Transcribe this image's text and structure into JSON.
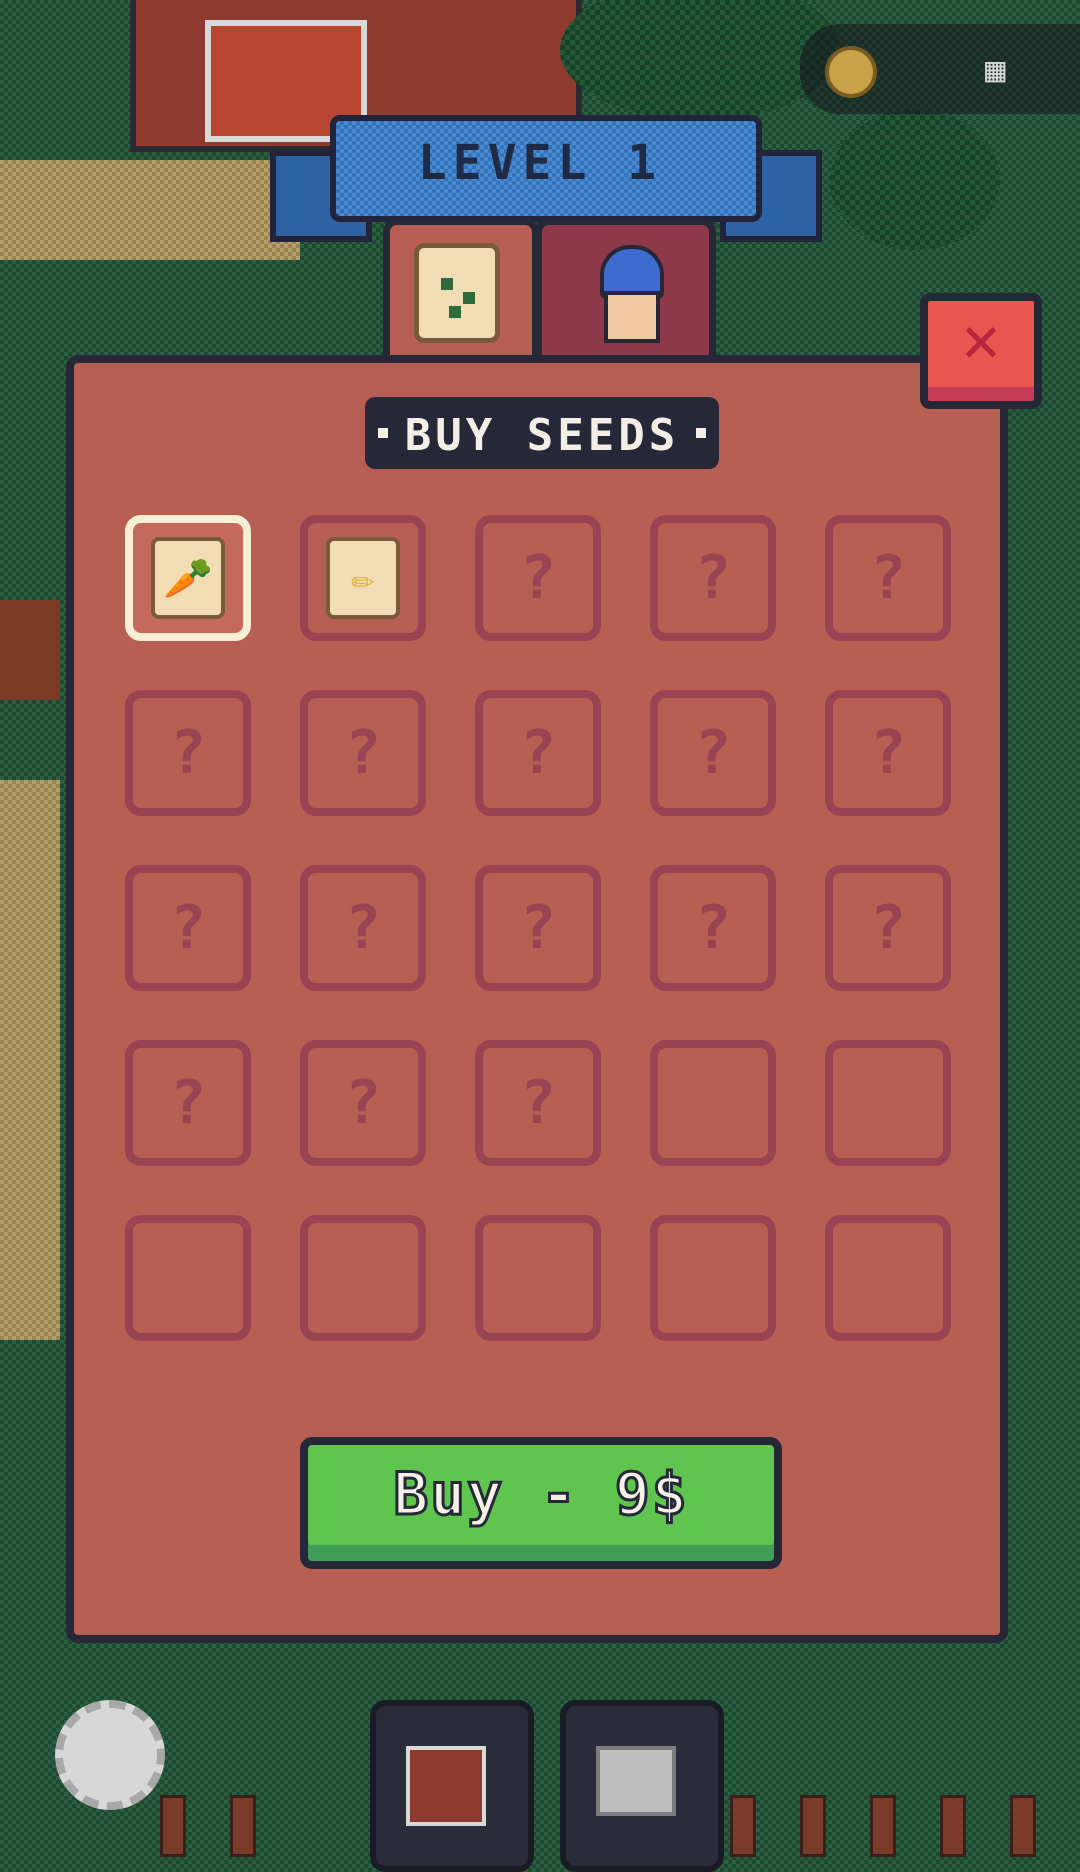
{
  "level_label": "LEVEL 1",
  "shop": {
    "title": "BUY SEEDS",
    "tabs": [
      {
        "name": "seeds",
        "icon": "seed-bag-icon"
      },
      {
        "name": "character",
        "icon": "bunny-character-icon"
      }
    ],
    "slots_row1": [
      {
        "state": "selected",
        "icon": "carrot-seed-icon"
      },
      {
        "state": "owned",
        "icon": "corn-seed-icon"
      },
      {
        "state": "locked",
        "label": "?"
      },
      {
        "state": "locked",
        "label": "?"
      },
      {
        "state": "locked",
        "label": "?"
      }
    ],
    "locked_label": "?",
    "buy_label": "Buy - 9$"
  },
  "colors": {
    "panel": "#b65f52",
    "outline": "#262838",
    "buy": "#5fc54e",
    "close": "#e8564f",
    "slot_border": "#9a4353"
  }
}
